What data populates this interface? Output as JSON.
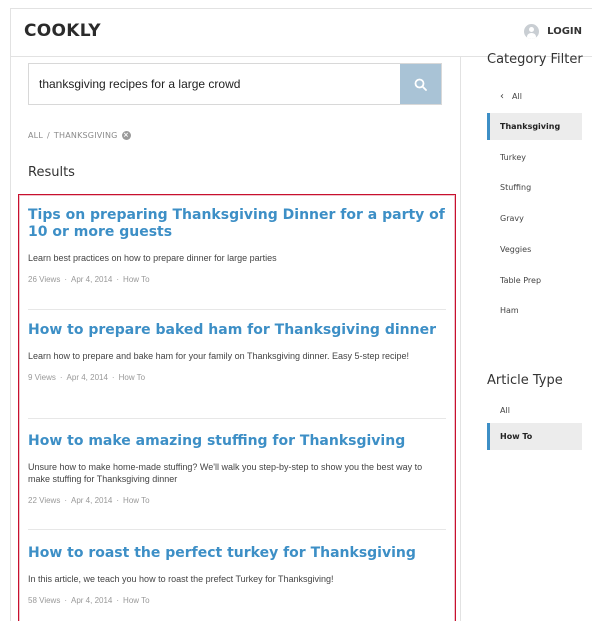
{
  "header": {
    "logo": "COOKLY",
    "login_label": "LOGIN"
  },
  "search": {
    "query": "thanksgiving recipes for a large crowd",
    "placeholder": ""
  },
  "breadcrumb": {
    "root": "ALL",
    "separator": "/",
    "current": "THANKSGIVING"
  },
  "results_heading": "Results",
  "results": [
    {
      "title": "Tips on preparing Thanksgiving Dinner for a party of 10 or more guests",
      "desc": "Learn best practices on how to prepare dinner for large parties",
      "views": "26 Views",
      "date": "Apr 4, 2014",
      "category": "How To"
    },
    {
      "title": "How to prepare baked ham for Thanksgiving dinner",
      "desc": "Learn how to prepare and bake ham for your family on Thanksgiving dinner. Easy 5-step recipe!",
      "views": "9 Views",
      "date": "Apr 4, 2014",
      "category": "How To"
    },
    {
      "title": "How to make amazing stuffing for Thanksgiving",
      "desc": "Unsure how to make home-made stuffing? We'll walk you step-by-step to show you the best way to make stuffing for Thanksgiving dinner",
      "views": "22 Views",
      "date": "Apr 4, 2014",
      "category": "How To"
    },
    {
      "title": "How to roast the perfect turkey for Thanksgiving",
      "desc": "In this article, we teach you how to roast the prefect Turkey for Thanksgiving!",
      "views": "58 Views",
      "date": "Apr 4, 2014",
      "category": "How To"
    }
  ],
  "category_filter": {
    "heading": "Category Filter",
    "back_label": "All",
    "items": [
      "Thanksgiving",
      "Turkey",
      "Stuffing",
      "Gravy",
      "Veggies",
      "Table Prep",
      "Ham"
    ],
    "active": "Thanksgiving"
  },
  "article_type": {
    "heading": "Article Type",
    "items": [
      "All",
      "How To"
    ],
    "active": "How To"
  },
  "colors": {
    "accent": "#3d8fc6",
    "search_button": "#a9c3d6",
    "highlight_border": "#c8102e"
  }
}
